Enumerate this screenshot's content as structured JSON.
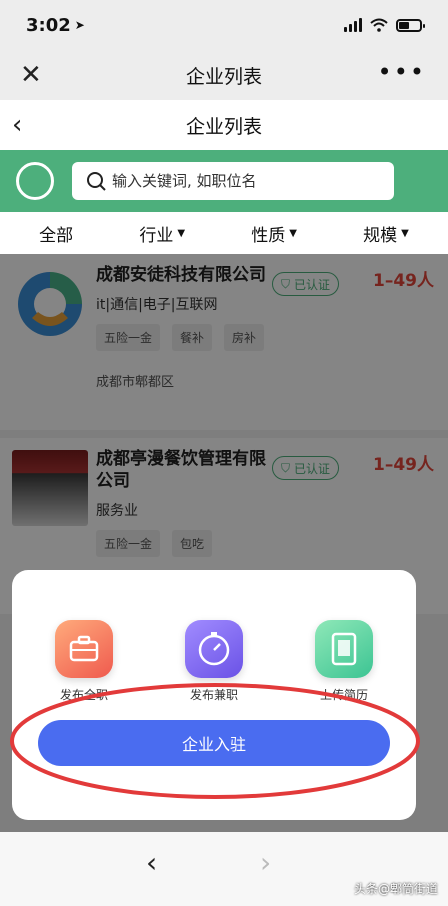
{
  "status": {
    "time": "3:02"
  },
  "wechat": {
    "title": "企业列表"
  },
  "page": {
    "title": "企业列表"
  },
  "search": {
    "placeholder": "输入关键词, 如职位名"
  },
  "filters": [
    "全部",
    "行业",
    "性质",
    "规模"
  ],
  "companies": [
    {
      "name": "成都安徒科技有限公司",
      "badge": "已认证",
      "size": "1–49人",
      "industry": "it|通信|电子|互联网",
      "tags": [
        "五险一金",
        "餐补",
        "房补"
      ],
      "location": "成都市郫都区"
    },
    {
      "name": "成都亭漫餐饮管理有限公司",
      "badge": "已认证",
      "size": "1–49人",
      "industry": "服务业",
      "tags": [
        "五险一金",
        "包吃"
      ]
    }
  ],
  "sheet": {
    "actions": [
      {
        "label": "发布全职",
        "icon": "briefcase-icon"
      },
      {
        "label": "发布兼职",
        "icon": "clock-icon"
      },
      {
        "label": "上传简历",
        "icon": "document-icon"
      }
    ],
    "join_label": "企业入驻"
  },
  "colors": {
    "accent": "#4daf7c",
    "primary_button": "#4a6cf0",
    "highlight_ring": "#e23a3a",
    "size_text": "#e2453b"
  },
  "watermark": "头条@郫筒街道"
}
